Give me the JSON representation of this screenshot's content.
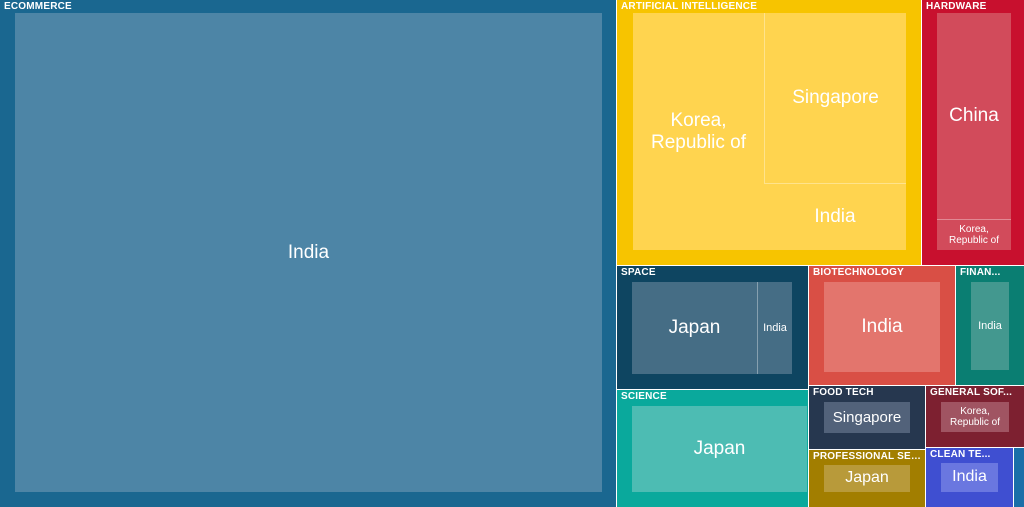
{
  "chart_data": {
    "type": "treemap",
    "categories": [
      {
        "name": "ECOMMERCE",
        "color": "#1a6790",
        "leaf_color": "#4d85a6",
        "children": [
          {
            "label": "India"
          }
        ]
      },
      {
        "name": "ARTIFICIAL INTELLIGENCE",
        "color": "#f7c400",
        "leaf_color": "#ffd44f",
        "children": [
          {
            "label": "Korea, Republic of"
          },
          {
            "label": "Singapore"
          },
          {
            "label": "India"
          }
        ]
      },
      {
        "name": "HARDWARE",
        "color": "#c8102e",
        "leaf_color": "#d24b5b",
        "children": [
          {
            "label": "China"
          },
          {
            "label": "Korea, Republic of"
          }
        ]
      },
      {
        "name": "SPACE",
        "color": "#0e4561",
        "leaf_color": "#456d85",
        "children": [
          {
            "label": "Japan"
          },
          {
            "label": "India"
          }
        ]
      },
      {
        "name": "BIOTECHNOLOGY",
        "color": "#d94f45",
        "leaf_color": "#e3756d",
        "children": [
          {
            "label": "India"
          }
        ]
      },
      {
        "name": "FINAN...",
        "color": "#0a7e72",
        "leaf_color": "#43988f",
        "children": [
          {
            "label": "India"
          }
        ]
      },
      {
        "name": "SCIENCE",
        "color": "#0aa99c",
        "leaf_color": "#4dbcb3",
        "children": [
          {
            "label": "Japan"
          }
        ]
      },
      {
        "name": "FOOD TECH",
        "color": "#26374f",
        "leaf_color": "#52627a",
        "children": [
          {
            "label": "Singapore"
          }
        ]
      },
      {
        "name": "GENERAL SOF...",
        "color": "#7d2030",
        "leaf_color": "#a05462",
        "children": [
          {
            "label": "Korea, Republic of"
          }
        ]
      },
      {
        "name": "PROFESSIONAL SER...",
        "color": "#a27e00",
        "leaf_color": "#b89a3a",
        "children": [
          {
            "label": "Japan"
          }
        ]
      },
      {
        "name": "CLEAN TE...",
        "color": "#3f4fd1",
        "leaf_color": "#6a77e0",
        "children": [
          {
            "label": "India"
          }
        ]
      },
      {
        "name": "",
        "color": "#1a6fa8",
        "leaf_color": "#1a6fa8",
        "children": []
      }
    ]
  }
}
